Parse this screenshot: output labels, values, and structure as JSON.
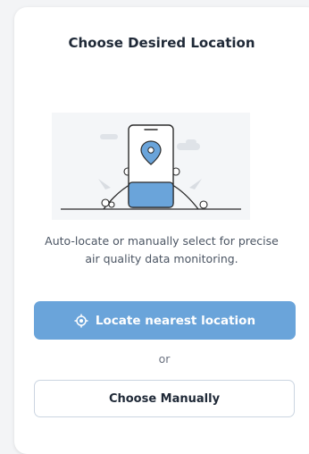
{
  "card": {
    "title": "Choose Desired Location",
    "description": "Auto-locate or manually select for precise air quality data monitoring.",
    "illustration_icon": "phone-location-illustration"
  },
  "actions": {
    "locate_label": "Locate nearest location",
    "locate_icon": "crosshair-icon",
    "separator": "or",
    "manual_label": "Choose Manually"
  },
  "colors": {
    "primary": "#6aa4da",
    "title_text": "#1f2937",
    "body_text": "#4b5563",
    "outline": "#cbd5e1"
  }
}
